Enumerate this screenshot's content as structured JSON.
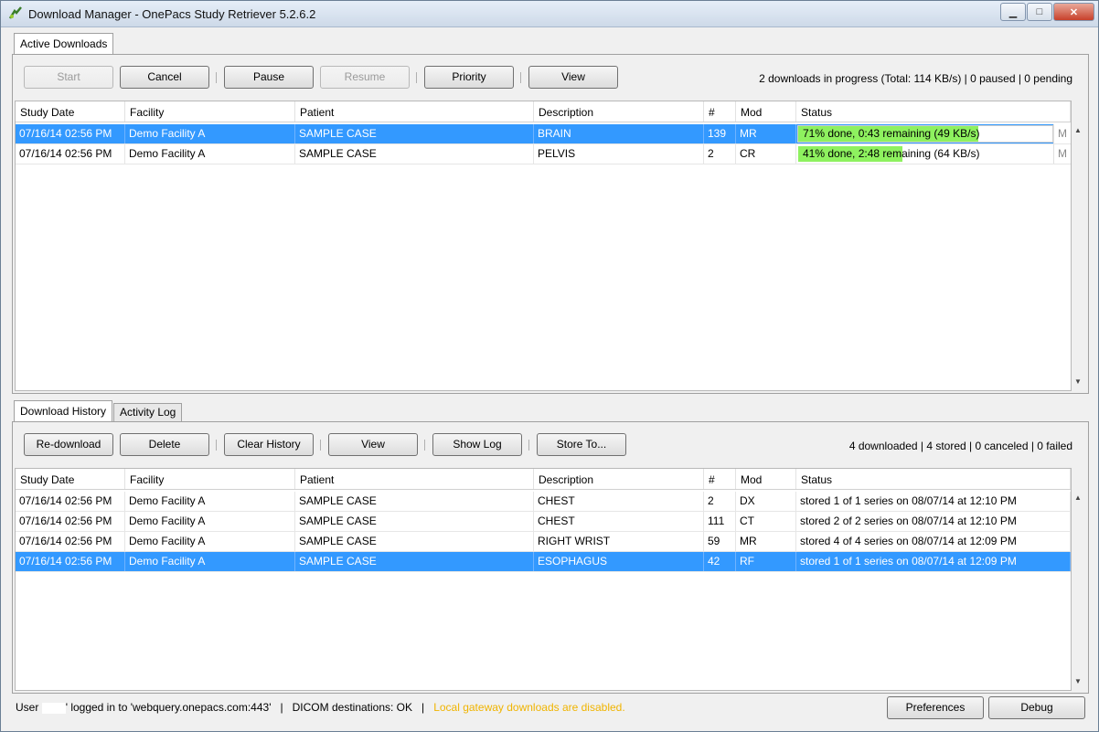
{
  "window": {
    "title": "Download Manager - OnePacs Study Retriever 5.2.6.2",
    "minimize": "▁",
    "maximize": "□",
    "close": "✕"
  },
  "active": {
    "tab_label": "Active Downloads",
    "buttons": {
      "start": "Start",
      "cancel": "Cancel",
      "pause": "Pause",
      "resume": "Resume",
      "priority": "Priority",
      "view": "View"
    },
    "status": "2  downloads  in progress (Total: 114 KB/s) | 0 paused | 0 pending",
    "columns": [
      "Study Date",
      "Facility",
      "Patient",
      "Description",
      "#",
      "Mod",
      "Status"
    ],
    "rows": [
      {
        "date": "07/16/14 02:56 PM",
        "facility": "Demo Facility A",
        "patient": "SAMPLE CASE",
        "description": "BRAIN",
        "count": "139",
        "mod": "MR",
        "status": "71% done, 0:43 remaining (49 KB/s)",
        "progress": 0.71,
        "m": "M",
        "selected": true
      },
      {
        "date": "07/16/14 02:56 PM",
        "facility": "Demo Facility A",
        "patient": "SAMPLE CASE",
        "description": "PELVIS",
        "count": "2",
        "mod": "CR",
        "status": "41% done, 2:48 remaining (64 KB/s)",
        "progress": 0.41,
        "m": "M",
        "selected": false
      }
    ]
  },
  "history": {
    "tabs": [
      "Download History",
      "Activity Log"
    ],
    "buttons": {
      "redownload": "Re-download",
      "delete": "Delete",
      "clear": "Clear History",
      "view": "View",
      "showlog": "Show Log",
      "storeto": "Store To..."
    },
    "status": "4 downloaded | 4 stored | 0 canceled | 0 failed",
    "columns": [
      "Study Date",
      "Facility",
      "Patient",
      "Description",
      "#",
      "Mod",
      "Status"
    ],
    "rows": [
      {
        "date": "07/16/14 02:56 PM",
        "facility": "Demo Facility A",
        "patient": "SAMPLE CASE",
        "description": "CHEST",
        "count": "2",
        "mod": "DX",
        "status": "stored 1 of 1 series on 08/07/14 at 12:10 PM",
        "selected": false
      },
      {
        "date": "07/16/14 02:56 PM",
        "facility": "Demo Facility A",
        "patient": "SAMPLE CASE",
        "description": "CHEST",
        "count": "111",
        "mod": "CT",
        "status": "stored 2 of 2 series on 08/07/14 at 12:10 PM",
        "selected": false
      },
      {
        "date": "07/16/14 02:56 PM",
        "facility": "Demo Facility A",
        "patient": "SAMPLE CASE",
        "description": "RIGHT WRIST",
        "count": "59",
        "mod": "MR",
        "status": "stored 4 of 4 series on 08/07/14 at 12:09 PM",
        "selected": false
      },
      {
        "date": "07/16/14 02:56 PM",
        "facility": "Demo Facility A",
        "patient": "SAMPLE CASE",
        "description": "ESOPHAGUS",
        "count": "42",
        "mod": "RF",
        "status": "stored 1 of 1 series on 08/07/14 at 12:09 PM",
        "selected": true
      }
    ]
  },
  "footer": {
    "user_prefix": "User",
    "login_text": "' logged in to 'webquery.onepacs.com:443'",
    "sep": "|",
    "dicom": "DICOM destinations: OK",
    "warning": "Local gateway downloads are disabled.",
    "preferences": "Preferences",
    "debug": "Debug"
  },
  "colors": {
    "selection": "#3399ff",
    "progress": "#8ef15f",
    "warning": "#f0b400"
  }
}
